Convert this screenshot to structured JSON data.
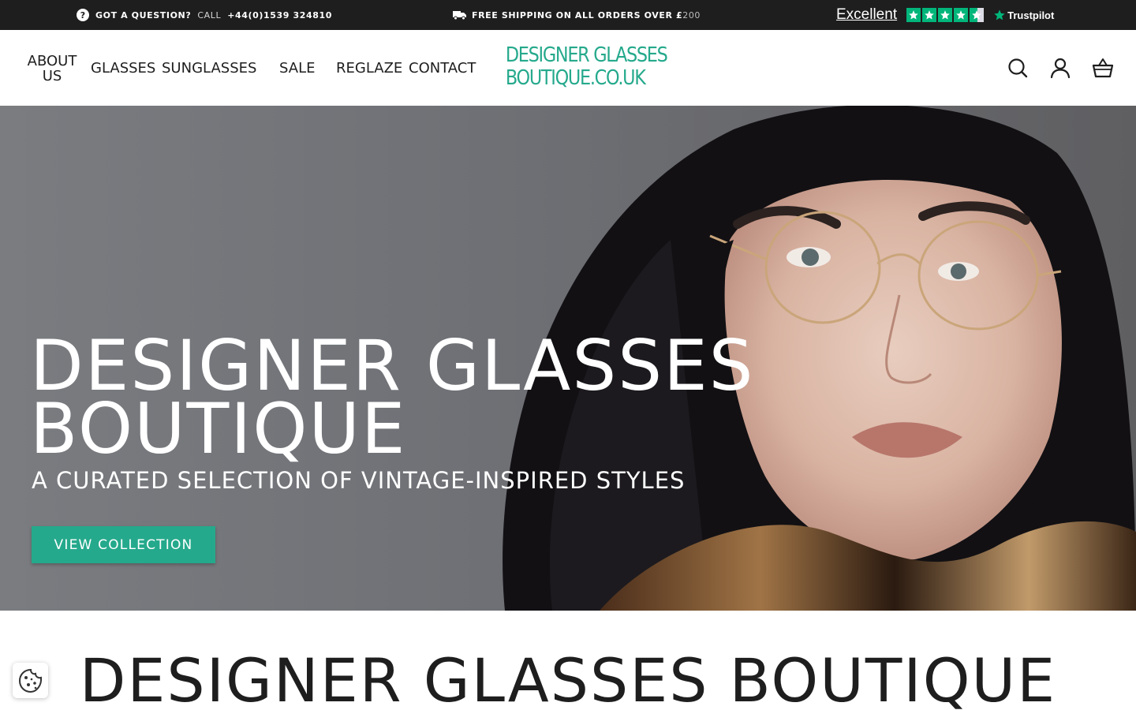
{
  "announcement": {
    "question_label": "GOT A QUESTION?",
    "call_label": "CALL",
    "phone": "+44(0)1539 324810",
    "shipping_text": "FREE SHIPPING ON ALL ORDERS OVER £",
    "shipping_amount": "200",
    "rating_label": "Excellent",
    "rating_stars": 4.5,
    "trustpilot_brand": "Trustpilot"
  },
  "nav": {
    "about_line1": "ABOUT",
    "about_line2": "US",
    "glasses": "GLASSES",
    "sunglasses": "SUNGLASSES",
    "sale": "SALE",
    "reglaze": "REGLAZE",
    "contact": "CONTACT"
  },
  "logo": {
    "line1": "DESIGNER GLASSES",
    "line2": "BOUTIQUE.CO.UK"
  },
  "header_icons": [
    "search-icon",
    "account-icon",
    "basket-icon"
  ],
  "hero": {
    "title_line1": "DESIGNER GLASSES",
    "title_line2": "BOUTIQUE",
    "subtitle": "A CURATED SELECTION OF VINTAGE-INSPIRED STYLES",
    "cta_label": "VIEW COLLECTION"
  },
  "section": {
    "title": "DESIGNER GLASSES BOUTIQUE"
  },
  "colors": {
    "brand_teal": "#25a98c",
    "topbar_bg": "#1e1e1e",
    "trustpilot_green": "#00b67a"
  }
}
